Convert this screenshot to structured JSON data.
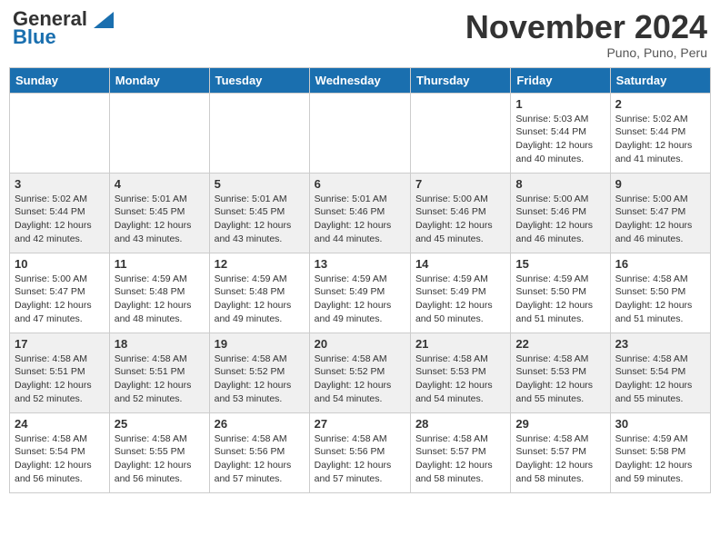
{
  "header": {
    "logo_line1": "General",
    "logo_line2": "Blue",
    "month": "November 2024",
    "location": "Puno, Puno, Peru"
  },
  "days_of_week": [
    "Sunday",
    "Monday",
    "Tuesday",
    "Wednesday",
    "Thursday",
    "Friday",
    "Saturday"
  ],
  "weeks": [
    [
      {
        "day": "",
        "info": ""
      },
      {
        "day": "",
        "info": ""
      },
      {
        "day": "",
        "info": ""
      },
      {
        "day": "",
        "info": ""
      },
      {
        "day": "",
        "info": ""
      },
      {
        "day": "1",
        "info": "Sunrise: 5:03 AM\nSunset: 5:44 PM\nDaylight: 12 hours\nand 40 minutes."
      },
      {
        "day": "2",
        "info": "Sunrise: 5:02 AM\nSunset: 5:44 PM\nDaylight: 12 hours\nand 41 minutes."
      }
    ],
    [
      {
        "day": "3",
        "info": "Sunrise: 5:02 AM\nSunset: 5:44 PM\nDaylight: 12 hours\nand 42 minutes."
      },
      {
        "day": "4",
        "info": "Sunrise: 5:01 AM\nSunset: 5:45 PM\nDaylight: 12 hours\nand 43 minutes."
      },
      {
        "day": "5",
        "info": "Sunrise: 5:01 AM\nSunset: 5:45 PM\nDaylight: 12 hours\nand 43 minutes."
      },
      {
        "day": "6",
        "info": "Sunrise: 5:01 AM\nSunset: 5:46 PM\nDaylight: 12 hours\nand 44 minutes."
      },
      {
        "day": "7",
        "info": "Sunrise: 5:00 AM\nSunset: 5:46 PM\nDaylight: 12 hours\nand 45 minutes."
      },
      {
        "day": "8",
        "info": "Sunrise: 5:00 AM\nSunset: 5:46 PM\nDaylight: 12 hours\nand 46 minutes."
      },
      {
        "day": "9",
        "info": "Sunrise: 5:00 AM\nSunset: 5:47 PM\nDaylight: 12 hours\nand 46 minutes."
      }
    ],
    [
      {
        "day": "10",
        "info": "Sunrise: 5:00 AM\nSunset: 5:47 PM\nDaylight: 12 hours\nand 47 minutes."
      },
      {
        "day": "11",
        "info": "Sunrise: 4:59 AM\nSunset: 5:48 PM\nDaylight: 12 hours\nand 48 minutes."
      },
      {
        "day": "12",
        "info": "Sunrise: 4:59 AM\nSunset: 5:48 PM\nDaylight: 12 hours\nand 49 minutes."
      },
      {
        "day": "13",
        "info": "Sunrise: 4:59 AM\nSunset: 5:49 PM\nDaylight: 12 hours\nand 49 minutes."
      },
      {
        "day": "14",
        "info": "Sunrise: 4:59 AM\nSunset: 5:49 PM\nDaylight: 12 hours\nand 50 minutes."
      },
      {
        "day": "15",
        "info": "Sunrise: 4:59 AM\nSunset: 5:50 PM\nDaylight: 12 hours\nand 51 minutes."
      },
      {
        "day": "16",
        "info": "Sunrise: 4:58 AM\nSunset: 5:50 PM\nDaylight: 12 hours\nand 51 minutes."
      }
    ],
    [
      {
        "day": "17",
        "info": "Sunrise: 4:58 AM\nSunset: 5:51 PM\nDaylight: 12 hours\nand 52 minutes."
      },
      {
        "day": "18",
        "info": "Sunrise: 4:58 AM\nSunset: 5:51 PM\nDaylight: 12 hours\nand 52 minutes."
      },
      {
        "day": "19",
        "info": "Sunrise: 4:58 AM\nSunset: 5:52 PM\nDaylight: 12 hours\nand 53 minutes."
      },
      {
        "day": "20",
        "info": "Sunrise: 4:58 AM\nSunset: 5:52 PM\nDaylight: 12 hours\nand 54 minutes."
      },
      {
        "day": "21",
        "info": "Sunrise: 4:58 AM\nSunset: 5:53 PM\nDaylight: 12 hours\nand 54 minutes."
      },
      {
        "day": "22",
        "info": "Sunrise: 4:58 AM\nSunset: 5:53 PM\nDaylight: 12 hours\nand 55 minutes."
      },
      {
        "day": "23",
        "info": "Sunrise: 4:58 AM\nSunset: 5:54 PM\nDaylight: 12 hours\nand 55 minutes."
      }
    ],
    [
      {
        "day": "24",
        "info": "Sunrise: 4:58 AM\nSunset: 5:54 PM\nDaylight: 12 hours\nand 56 minutes."
      },
      {
        "day": "25",
        "info": "Sunrise: 4:58 AM\nSunset: 5:55 PM\nDaylight: 12 hours\nand 56 minutes."
      },
      {
        "day": "26",
        "info": "Sunrise: 4:58 AM\nSunset: 5:56 PM\nDaylight: 12 hours\nand 57 minutes."
      },
      {
        "day": "27",
        "info": "Sunrise: 4:58 AM\nSunset: 5:56 PM\nDaylight: 12 hours\nand 57 minutes."
      },
      {
        "day": "28",
        "info": "Sunrise: 4:58 AM\nSunset: 5:57 PM\nDaylight: 12 hours\nand 58 minutes."
      },
      {
        "day": "29",
        "info": "Sunrise: 4:58 AM\nSunset: 5:57 PM\nDaylight: 12 hours\nand 58 minutes."
      },
      {
        "day": "30",
        "info": "Sunrise: 4:59 AM\nSunset: 5:58 PM\nDaylight: 12 hours\nand 59 minutes."
      }
    ]
  ]
}
